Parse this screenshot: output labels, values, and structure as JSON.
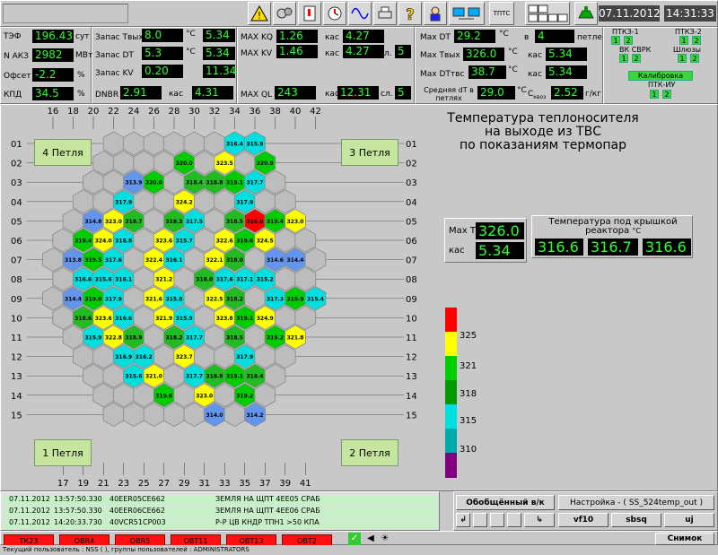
{
  "toolbar": {
    "icons": [
      "warning-icon",
      "gear-icon",
      "alarm-list-icon",
      "settings-icon",
      "sine-wave-icon",
      "printer-icon",
      "help-icon",
      "operator-icon",
      "network-icon"
    ],
    "ttps_label": "ТПТС",
    "tabs_label": [
      "1",
      "2",
      "3",
      "4"
    ],
    "date": "07.11.2012",
    "time": "14:31:33"
  },
  "params": {
    "tef": {
      "label": "ТЭФ",
      "value": "196.43",
      "unit": "сут"
    },
    "nakz": {
      "label": "N АКЗ",
      "value": "2982",
      "unit": "МВт"
    },
    "ofset": {
      "label": "Офсет",
      "value": "-2.2",
      "unit": "%"
    },
    "kpd": {
      "label": "КПД",
      "value": "34.5",
      "unit": "%"
    },
    "zap_tvx": {
      "label": "Запас Tвых",
      "value": "8.0",
      "unit": "°C",
      "value2": "5.34"
    },
    "zap_dt": {
      "label": "Запас DT",
      "value": "5.3",
      "unit": "°C",
      "value2": "5.34"
    },
    "zap_kv": {
      "label": "Запас KV",
      "value": "0.20",
      "value2": "11.34"
    },
    "dnbr": {
      "label": "DNBR",
      "value": "2.91",
      "kas": "кас",
      "value2": "4.31"
    },
    "max_kq": {
      "label": "MAX KQ",
      "value": "1.26",
      "kas": "кас",
      "value2": "4.27"
    },
    "max_kv": {
      "label": "MAX KV",
      "value": "1.46",
      "kas": "кас",
      "value2": "4.27",
      "sl": "сл.",
      "value3": "5"
    },
    "max_ql": {
      "label": "MAX QL",
      "value": "243",
      "kas": "кас",
      "value2": "12.31",
      "sl": "сл.",
      "value3": "5"
    },
    "max_dt": {
      "label": "Max DT",
      "value": "29.2",
      "unit": "°C",
      "b": "в",
      "value2": "4",
      "loop": "петле"
    },
    "max_tvx": {
      "label": "Max Tвых",
      "value": "326.0",
      "unit": "°C",
      "kas": "кас",
      "value2": "5.34"
    },
    "max_dttvs": {
      "label": "Max DTтвс",
      "value": "38.7",
      "unit": "°C",
      "kas": "кас",
      "value2": "5.34"
    },
    "sred_dt": {
      "label": "Средняя dT в петлях",
      "value": "29.0",
      "unit": "°C",
      "c": "C",
      "c_sub": "квоз",
      "value2": "2.52",
      "unit2": "г/кг"
    }
  },
  "ptkz": {
    "ptkz1": "ПТКЗ-1",
    "ptkz2": "ПТКЗ-2",
    "vk_svrk": "ВК СВРК",
    "shlyuzy": "Шлюзы",
    "kalibrovka": "Калибровка",
    "ptk_iu": "ПТК-ИУ",
    "b1": "1",
    "b2": "2"
  },
  "title_text": [
    "Температура теплоносителя",
    "на выходе из ТВС",
    "по показаниям термопар"
  ],
  "loops": {
    "l1": "1 Петля",
    "l2": "2 Петля",
    "l3": "3 Петля",
    "l4": "4 Петля"
  },
  "maxbox": {
    "max_label": "Max T",
    "max_value": "326.0",
    "kas_label": "кас",
    "kas_value": "5.34"
  },
  "lid": {
    "title": "Температура под крышкой реактора",
    "unit": "°C",
    "values": [
      "316.6",
      "316.7",
      "316.6"
    ]
  },
  "legend": {
    "ticks": [
      "325",
      "321",
      "318",
      "315",
      "310"
    ],
    "colors": [
      "#ff0000",
      "#ffff00",
      "#00cc00",
      "#009900",
      "#00e0e0",
      "#00aaaa",
      "#6495ed",
      "#800080"
    ]
  },
  "axes": {
    "top": [
      "16",
      "18",
      "20",
      "22",
      "24",
      "26",
      "28",
      "30",
      "32",
      "34",
      "36",
      "38",
      "40",
      "42"
    ],
    "bottom": [
      "17",
      "19",
      "21",
      "23",
      "25",
      "27",
      "29",
      "31",
      "33",
      "35",
      "37",
      "39",
      "41"
    ],
    "rows": [
      "01",
      "02",
      "03",
      "04",
      "05",
      "06",
      "07",
      "08",
      "09",
      "10",
      "11",
      "12",
      "13",
      "14",
      "15"
    ]
  },
  "core": {
    "rows": [
      [
        null,
        null,
        null,
        null,
        null,
        null,
        "316.4",
        "315.9",
        null,
        null,
        null,
        null,
        null,
        null
      ],
      [
        null,
        null,
        null,
        null,
        "320.0",
        null,
        "323.5",
        null,
        "320.9",
        null,
        null,
        null,
        null
      ],
      [
        null,
        null,
        "313.9",
        "320.0",
        null,
        "318.4",
        "318.8",
        "319.1",
        "317.7",
        null,
        "320.4",
        "313.7",
        null,
        null
      ],
      [
        null,
        null,
        "317.9",
        null,
        null,
        "324.2",
        null,
        null,
        "317.9",
        null,
        null,
        null,
        null
      ],
      [
        null,
        "314.8",
        "323.0",
        "318.7",
        null,
        "318.3",
        "317.5",
        null,
        "318.5",
        "326.0",
        "319.4",
        "323.0",
        "315.1",
        null
      ],
      [
        null,
        "319.4",
        "324.0",
        "316.8",
        null,
        "323.6",
        "315.7",
        null,
        "322.6",
        "319.6",
        "324.5",
        null,
        null
      ],
      [
        null,
        "313.8",
        "319.5",
        "317.6",
        null,
        "322.4",
        "316.1",
        null,
        "322.1",
        "318.0",
        null,
        "314.6",
        "314.4",
        null
      ],
      [
        null,
        "316.6",
        "315.6",
        "316.1",
        null,
        "321.2",
        null,
        "318.0",
        "317.6",
        "317.1",
        "315.2",
        null,
        null
      ],
      [
        null,
        "314.4",
        "319.0",
        "317.9",
        null,
        "321.6",
        "315.8",
        null,
        "322.5",
        "318.2",
        null,
        "317.3",
        "319.9",
        "315.4"
      ],
      [
        null,
        "318.6",
        "323.6",
        "316.6",
        null,
        "321.9",
        "315.9",
        null,
        "323.8",
        "319.1",
        "324.9",
        null,
        null
      ],
      [
        null,
        "315.9",
        "322.8",
        "318.9",
        null,
        "318.2",
        "317.7",
        null,
        "318.5",
        null,
        "319.2",
        "321.8",
        "315.7",
        null
      ],
      [
        null,
        null,
        "316.9",
        "316.2",
        null,
        "323.7",
        null,
        null,
        "317.9",
        null,
        null,
        null,
        null
      ],
      [
        null,
        null,
        "315.6",
        "321.0",
        null,
        "317.7",
        "318.8",
        "319.1",
        "318.4",
        null,
        "317.8",
        "313.3",
        null,
        null
      ],
      [
        null,
        null,
        null,
        "319.6",
        null,
        "323.0",
        null,
        "319.2",
        null,
        null,
        null,
        null,
        null
      ],
      [
        null,
        null,
        null,
        null,
        null,
        "314.0",
        null,
        "314.2",
        null,
        null,
        null,
        null,
        null,
        null
      ]
    ]
  },
  "events": [
    {
      "date": "07.11.2012",
      "time": "13:57:50.330",
      "code": "40EER05CE662",
      "text": "ЗЕМЛЯ НА ЩПТ 4ЕЕ05 СРАБ"
    },
    {
      "date": "07.11.2012",
      "time": "13:57:50.330",
      "code": "40EER06CE662",
      "text": "ЗЕМЛЯ НА ЩПТ 4ЕЕ06 СРАБ"
    },
    {
      "date": "07.11.2012",
      "time": "14:20:33.730",
      "code": "40VCR51CP003",
      "text": "Р-Р ЦВ КНДР ТПН1 >50 КПА"
    }
  ],
  "controls": {
    "obob": "Обобщённый в/к",
    "nastroyka": "Настройка - ( SS_524temp_out )",
    "vf10": "vf10",
    "sbsq": "sbsq",
    "uj": "uj",
    "snimok": "Снимок"
  },
  "redbuttons": [
    "ТК23",
    "OBR4",
    "OBR5",
    "OBT11",
    "OBT13",
    "OBT2"
  ],
  "status_bar": "Текущий пользователь : NSS ( ), группы пользователей : ADMINISTRATORS"
}
